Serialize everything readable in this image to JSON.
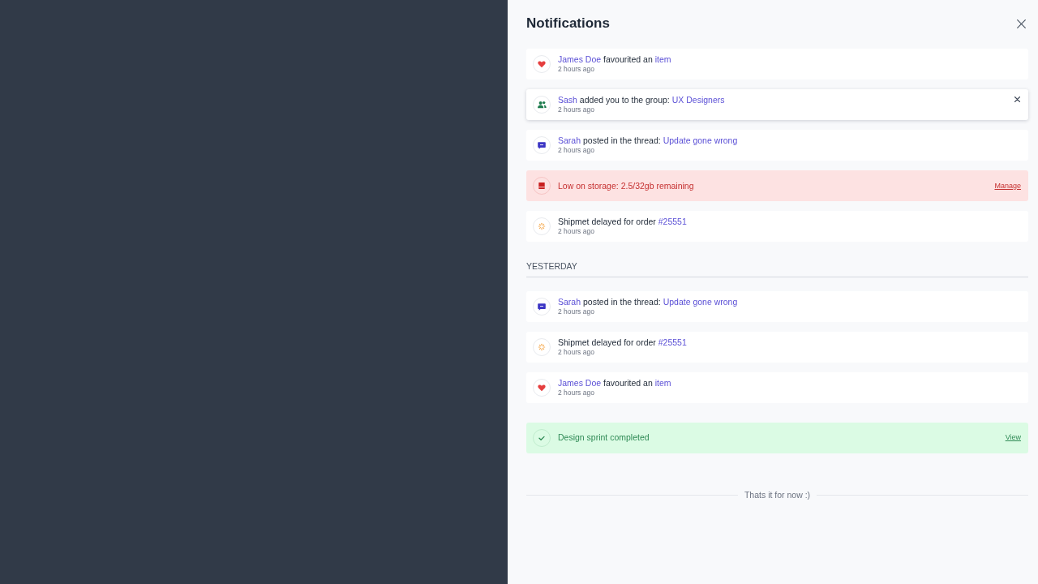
{
  "panel": {
    "title": "Notifications"
  },
  "groups": [
    {
      "items": [
        {
          "kind": "favourite",
          "hovered": false,
          "message": [
            {
              "text": "James Doe",
              "link": true
            },
            {
              "text": "favourited an",
              "link": false
            },
            {
              "text": "item",
              "link": true
            }
          ],
          "time": "2 hours ago"
        },
        {
          "kind": "group",
          "hovered": true,
          "message": [
            {
              "text": "Sash",
              "link": true
            },
            {
              "text": "added you to the group:",
              "link": false
            },
            {
              "text": "UX Designers",
              "link": true
            }
          ],
          "time": "2 hours ago"
        },
        {
          "kind": "thread",
          "hovered": false,
          "message": [
            {
              "text": "Sarah",
              "link": true
            },
            {
              "text": "posted in the thread:",
              "link": false
            },
            {
              "text": "Update gone wrong",
              "link": true
            }
          ],
          "time": "2 hours ago"
        },
        {
          "kind": "storage",
          "hovered": false,
          "message": [
            {
              "text": "Low on storage: 2.5/32gb remaining",
              "link": false
            }
          ],
          "action": "Manage"
        },
        {
          "kind": "shipment",
          "hovered": false,
          "message": [
            {
              "text": "Shipmet delayed for order",
              "link": false
            },
            {
              "text": "#25551",
              "link": true
            }
          ],
          "time": "2 hours ago"
        }
      ]
    },
    {
      "heading": "YESTERDAY",
      "items": [
        {
          "kind": "thread",
          "hovered": false,
          "message": [
            {
              "text": "Sarah",
              "link": true
            },
            {
              "text": "posted in the thread:",
              "link": false
            },
            {
              "text": "Update gone wrong",
              "link": true
            }
          ],
          "time": "2 hours ago"
        },
        {
          "kind": "shipment",
          "hovered": false,
          "message": [
            {
              "text": "Shipmet delayed for order",
              "link": false
            },
            {
              "text": "#25551",
              "link": true
            }
          ],
          "time": "2 hours ago"
        },
        {
          "kind": "favourite",
          "hovered": false,
          "message": [
            {
              "text": "James Doe",
              "link": true
            },
            {
              "text": "favourited an",
              "link": false
            },
            {
              "text": "item",
              "link": true
            }
          ],
          "time": "2 hours ago"
        }
      ]
    },
    {
      "items": [
        {
          "kind": "success",
          "hovered": false,
          "message": [
            {
              "text": "Design sprint completed",
              "link": false
            }
          ],
          "action": "View"
        }
      ]
    }
  ],
  "footer": "Thats it for now :)"
}
